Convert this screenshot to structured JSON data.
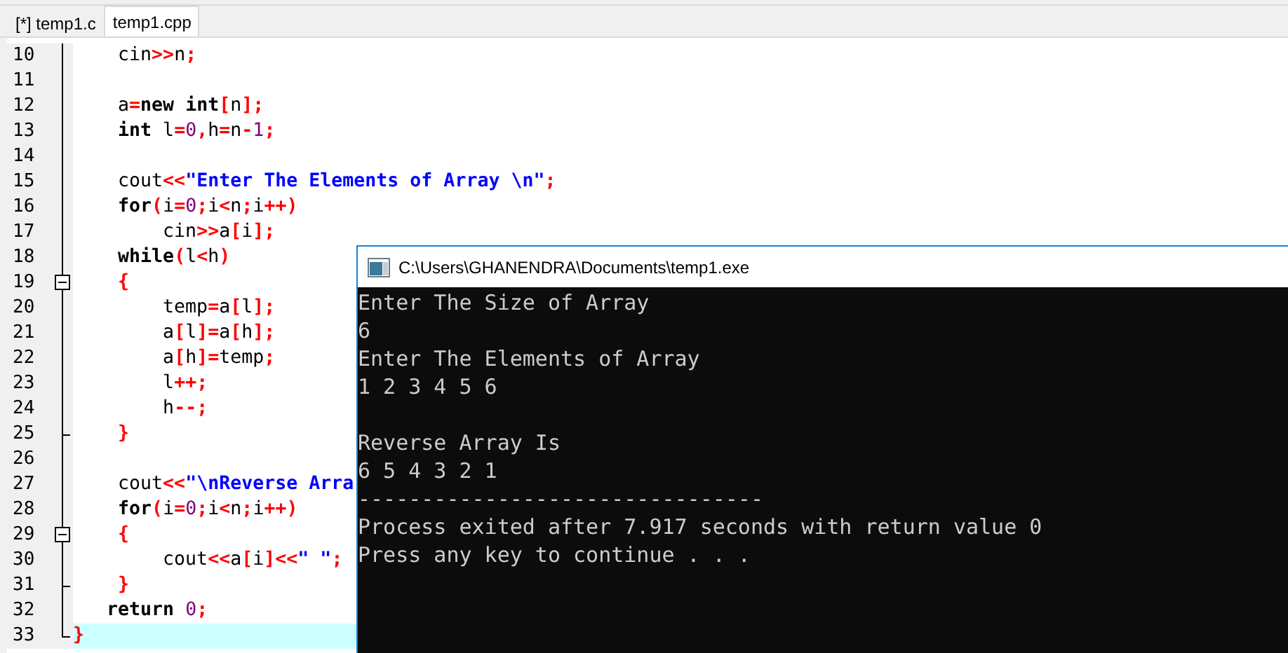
{
  "tabs": [
    {
      "label": "[*] temp1.c",
      "selected": false
    },
    {
      "label": "temp1.cpp",
      "selected": true
    }
  ],
  "lines": [
    {
      "number": "10",
      "kind": "plain",
      "current": false,
      "tokens": [
        {
          "kind": "plain",
          "text": "    cin"
        },
        {
          "kind": "operator",
          "text": ">>"
        },
        {
          "kind": "plain",
          "text": "n"
        },
        {
          "kind": "operator",
          "text": ";"
        }
      ]
    },
    {
      "number": "11",
      "kind": "plain",
      "current": false
    },
    {
      "number": "12",
      "kind": "plain",
      "current": false,
      "tokens": [
        {
          "kind": "plain",
          "text": "    a"
        },
        {
          "kind": "operator",
          "text": "="
        },
        {
          "kind": "keyword",
          "text": "new"
        },
        {
          "kind": "keyword",
          "text": " int"
        },
        {
          "kind": "operator",
          "text": "["
        },
        {
          "kind": "plain",
          "text": "n"
        },
        {
          "kind": "operator",
          "text": "];"
        }
      ]
    },
    {
      "number": "13",
      "kind": "plain",
      "current": false,
      "tokens": [
        {
          "kind": "keyword",
          "text": "    int"
        },
        {
          "kind": "plain",
          "text": " l"
        },
        {
          "kind": "operator",
          "text": "="
        },
        {
          "kind": "number",
          "text": "0"
        },
        {
          "kind": "operator",
          "text": ","
        },
        {
          "kind": "plain",
          "text": "h"
        },
        {
          "kind": "operator",
          "text": "="
        },
        {
          "kind": "plain",
          "text": "n"
        },
        {
          "kind": "operator",
          "text": "-"
        },
        {
          "kind": "number",
          "text": "1"
        },
        {
          "kind": "operator",
          "text": ";"
        }
      ]
    },
    {
      "number": "14",
      "kind": "plain",
      "current": false
    },
    {
      "number": "15",
      "kind": "plain",
      "current": false,
      "tokens": [
        {
          "kind": "plain",
          "text": "    cout"
        },
        {
          "kind": "operator",
          "text": "<<"
        },
        {
          "kind": "string",
          "text": "\"Enter The Elements of Array \\n\""
        },
        {
          "kind": "operator",
          "text": ";"
        }
      ]
    },
    {
      "number": "16",
      "kind": "plain",
      "current": false,
      "tokens": [
        {
          "kind": "keyword",
          "text": "    for"
        },
        {
          "kind": "operator",
          "text": "("
        },
        {
          "kind": "plain",
          "text": "i"
        },
        {
          "kind": "operator",
          "text": "="
        },
        {
          "kind": "number",
          "text": "0"
        },
        {
          "kind": "operator",
          "text": ";"
        },
        {
          "kind": "plain",
          "text": "i"
        },
        {
          "kind": "operator",
          "text": "<"
        },
        {
          "kind": "plain",
          "text": "n"
        },
        {
          "kind": "operator",
          "text": ";"
        },
        {
          "kind": "plain",
          "text": "i"
        },
        {
          "kind": "operator",
          "text": "++)"
        }
      ]
    },
    {
      "number": "17",
      "kind": "plain",
      "current": false,
      "tokens": [
        {
          "kind": "plain",
          "text": "        cin"
        },
        {
          "kind": "operator",
          "text": ">>"
        },
        {
          "kind": "plain",
          "text": "a"
        },
        {
          "kind": "operator",
          "text": "["
        },
        {
          "kind": "plain",
          "text": "i"
        },
        {
          "kind": "operator",
          "text": "];"
        }
      ]
    },
    {
      "number": "18",
      "kind": "plain",
      "current": false,
      "tokens": [
        {
          "kind": "keyword",
          "text": "    while"
        },
        {
          "kind": "operator",
          "text": "("
        },
        {
          "kind": "plain",
          "text": "l"
        },
        {
          "kind": "operator",
          "text": "<"
        },
        {
          "kind": "plain",
          "text": "h"
        },
        {
          "kind": "operator",
          "text": ")"
        }
      ]
    },
    {
      "number": "19",
      "kind": "fold-start",
      "current": false,
      "tokens": [
        {
          "kind": "operator",
          "text": "    {"
        }
      ]
    },
    {
      "number": "20",
      "kind": "plain",
      "current": false,
      "tokens": [
        {
          "kind": "plain",
          "text": "        temp"
        },
        {
          "kind": "operator",
          "text": "="
        },
        {
          "kind": "plain",
          "text": "a"
        },
        {
          "kind": "operator",
          "text": "["
        },
        {
          "kind": "plain",
          "text": "l"
        },
        {
          "kind": "operator",
          "text": "];"
        }
      ]
    },
    {
      "number": "21",
      "kind": "plain",
      "current": false,
      "tokens": [
        {
          "kind": "plain",
          "text": "        a"
        },
        {
          "kind": "operator",
          "text": "["
        },
        {
          "kind": "plain",
          "text": "l"
        },
        {
          "kind": "operator",
          "text": "]="
        },
        {
          "kind": "plain",
          "text": "a"
        },
        {
          "kind": "operator",
          "text": "["
        },
        {
          "kind": "plain",
          "text": "h"
        },
        {
          "kind": "operator",
          "text": "];"
        }
      ]
    },
    {
      "number": "22",
      "kind": "plain",
      "current": false,
      "tokens": [
        {
          "kind": "plain",
          "text": "        a"
        },
        {
          "kind": "operator",
          "text": "["
        },
        {
          "kind": "plain",
          "text": "h"
        },
        {
          "kind": "operator",
          "text": "]="
        },
        {
          "kind": "plain",
          "text": "temp"
        },
        {
          "kind": "operator",
          "text": ";"
        }
      ]
    },
    {
      "number": "23",
      "kind": "plain",
      "current": false,
      "tokens": [
        {
          "kind": "plain",
          "text": "        l"
        },
        {
          "kind": "operator",
          "text": "++;"
        }
      ]
    },
    {
      "number": "24",
      "kind": "plain",
      "current": false,
      "tokens": [
        {
          "kind": "plain",
          "text": "        h"
        },
        {
          "kind": "operator",
          "text": "--;"
        }
      ]
    },
    {
      "number": "25",
      "kind": "fold-end",
      "current": false,
      "tokens": [
        {
          "kind": "operator",
          "text": "    }"
        }
      ]
    },
    {
      "number": "26",
      "kind": "plain",
      "current": false
    },
    {
      "number": "27",
      "kind": "plain",
      "current": false,
      "tokens": [
        {
          "kind": "plain",
          "text": "    cout"
        },
        {
          "kind": "operator",
          "text": "<<"
        },
        {
          "kind": "string",
          "text": "\"\\nReverse Arra"
        }
      ]
    },
    {
      "number": "28",
      "kind": "plain",
      "current": false,
      "tokens": [
        {
          "kind": "keyword",
          "text": "    for"
        },
        {
          "kind": "operator",
          "text": "("
        },
        {
          "kind": "plain",
          "text": "i"
        },
        {
          "kind": "operator",
          "text": "="
        },
        {
          "kind": "number",
          "text": "0"
        },
        {
          "kind": "operator",
          "text": ";"
        },
        {
          "kind": "plain",
          "text": "i"
        },
        {
          "kind": "operator",
          "text": "<"
        },
        {
          "kind": "plain",
          "text": "n"
        },
        {
          "kind": "operator",
          "text": ";"
        },
        {
          "kind": "plain",
          "text": "i"
        },
        {
          "kind": "operator",
          "text": "++)"
        }
      ]
    },
    {
      "number": "29",
      "kind": "fold-start",
      "current": false,
      "tokens": [
        {
          "kind": "operator",
          "text": "    {"
        }
      ]
    },
    {
      "number": "30",
      "kind": "plain",
      "current": false,
      "tokens": [
        {
          "kind": "plain",
          "text": "        cout"
        },
        {
          "kind": "operator",
          "text": "<<"
        },
        {
          "kind": "plain",
          "text": "a"
        },
        {
          "kind": "operator",
          "text": "["
        },
        {
          "kind": "plain",
          "text": "i"
        },
        {
          "kind": "operator",
          "text": "]<<"
        },
        {
          "kind": "string",
          "text": "\" \""
        },
        {
          "kind": "operator",
          "text": ";"
        }
      ]
    },
    {
      "number": "31",
      "kind": "fold-end",
      "current": false,
      "tokens": [
        {
          "kind": "operator",
          "text": "    }"
        }
      ]
    },
    {
      "number": "32",
      "kind": "plain",
      "current": false,
      "tokens": [
        {
          "kind": "keyword",
          "text": "   return"
        },
        {
          "kind": "number",
          "text": " 0"
        },
        {
          "kind": "operator",
          "text": ";"
        }
      ]
    },
    {
      "number": "33",
      "kind": "fold-last",
      "current": true,
      "tokens": [
        {
          "kind": "operator",
          "text": "}"
        }
      ]
    }
  ],
  "console": {
    "title": "C:\\Users\\GHANENDRA\\Documents\\temp1.exe",
    "lines": [
      {
        "kind": "text",
        "text": "Enter The Size of Array"
      },
      {
        "kind": "text",
        "text": "6"
      },
      {
        "kind": "text",
        "text": "Enter The Elements of Array"
      },
      {
        "kind": "text",
        "text": "1 2 3 4 5 6"
      },
      {
        "kind": "blank"
      },
      {
        "kind": "text",
        "text": "Reverse Array Is"
      },
      {
        "kind": "text",
        "text": "6 5 4 3 2 1"
      },
      {
        "kind": "text",
        "text": "--------------------------------"
      },
      {
        "kind": "text",
        "text": "Process exited after 7.917 seconds with return value 0"
      },
      {
        "kind": "text",
        "text": "Press any key to continue . . ."
      }
    ]
  }
}
